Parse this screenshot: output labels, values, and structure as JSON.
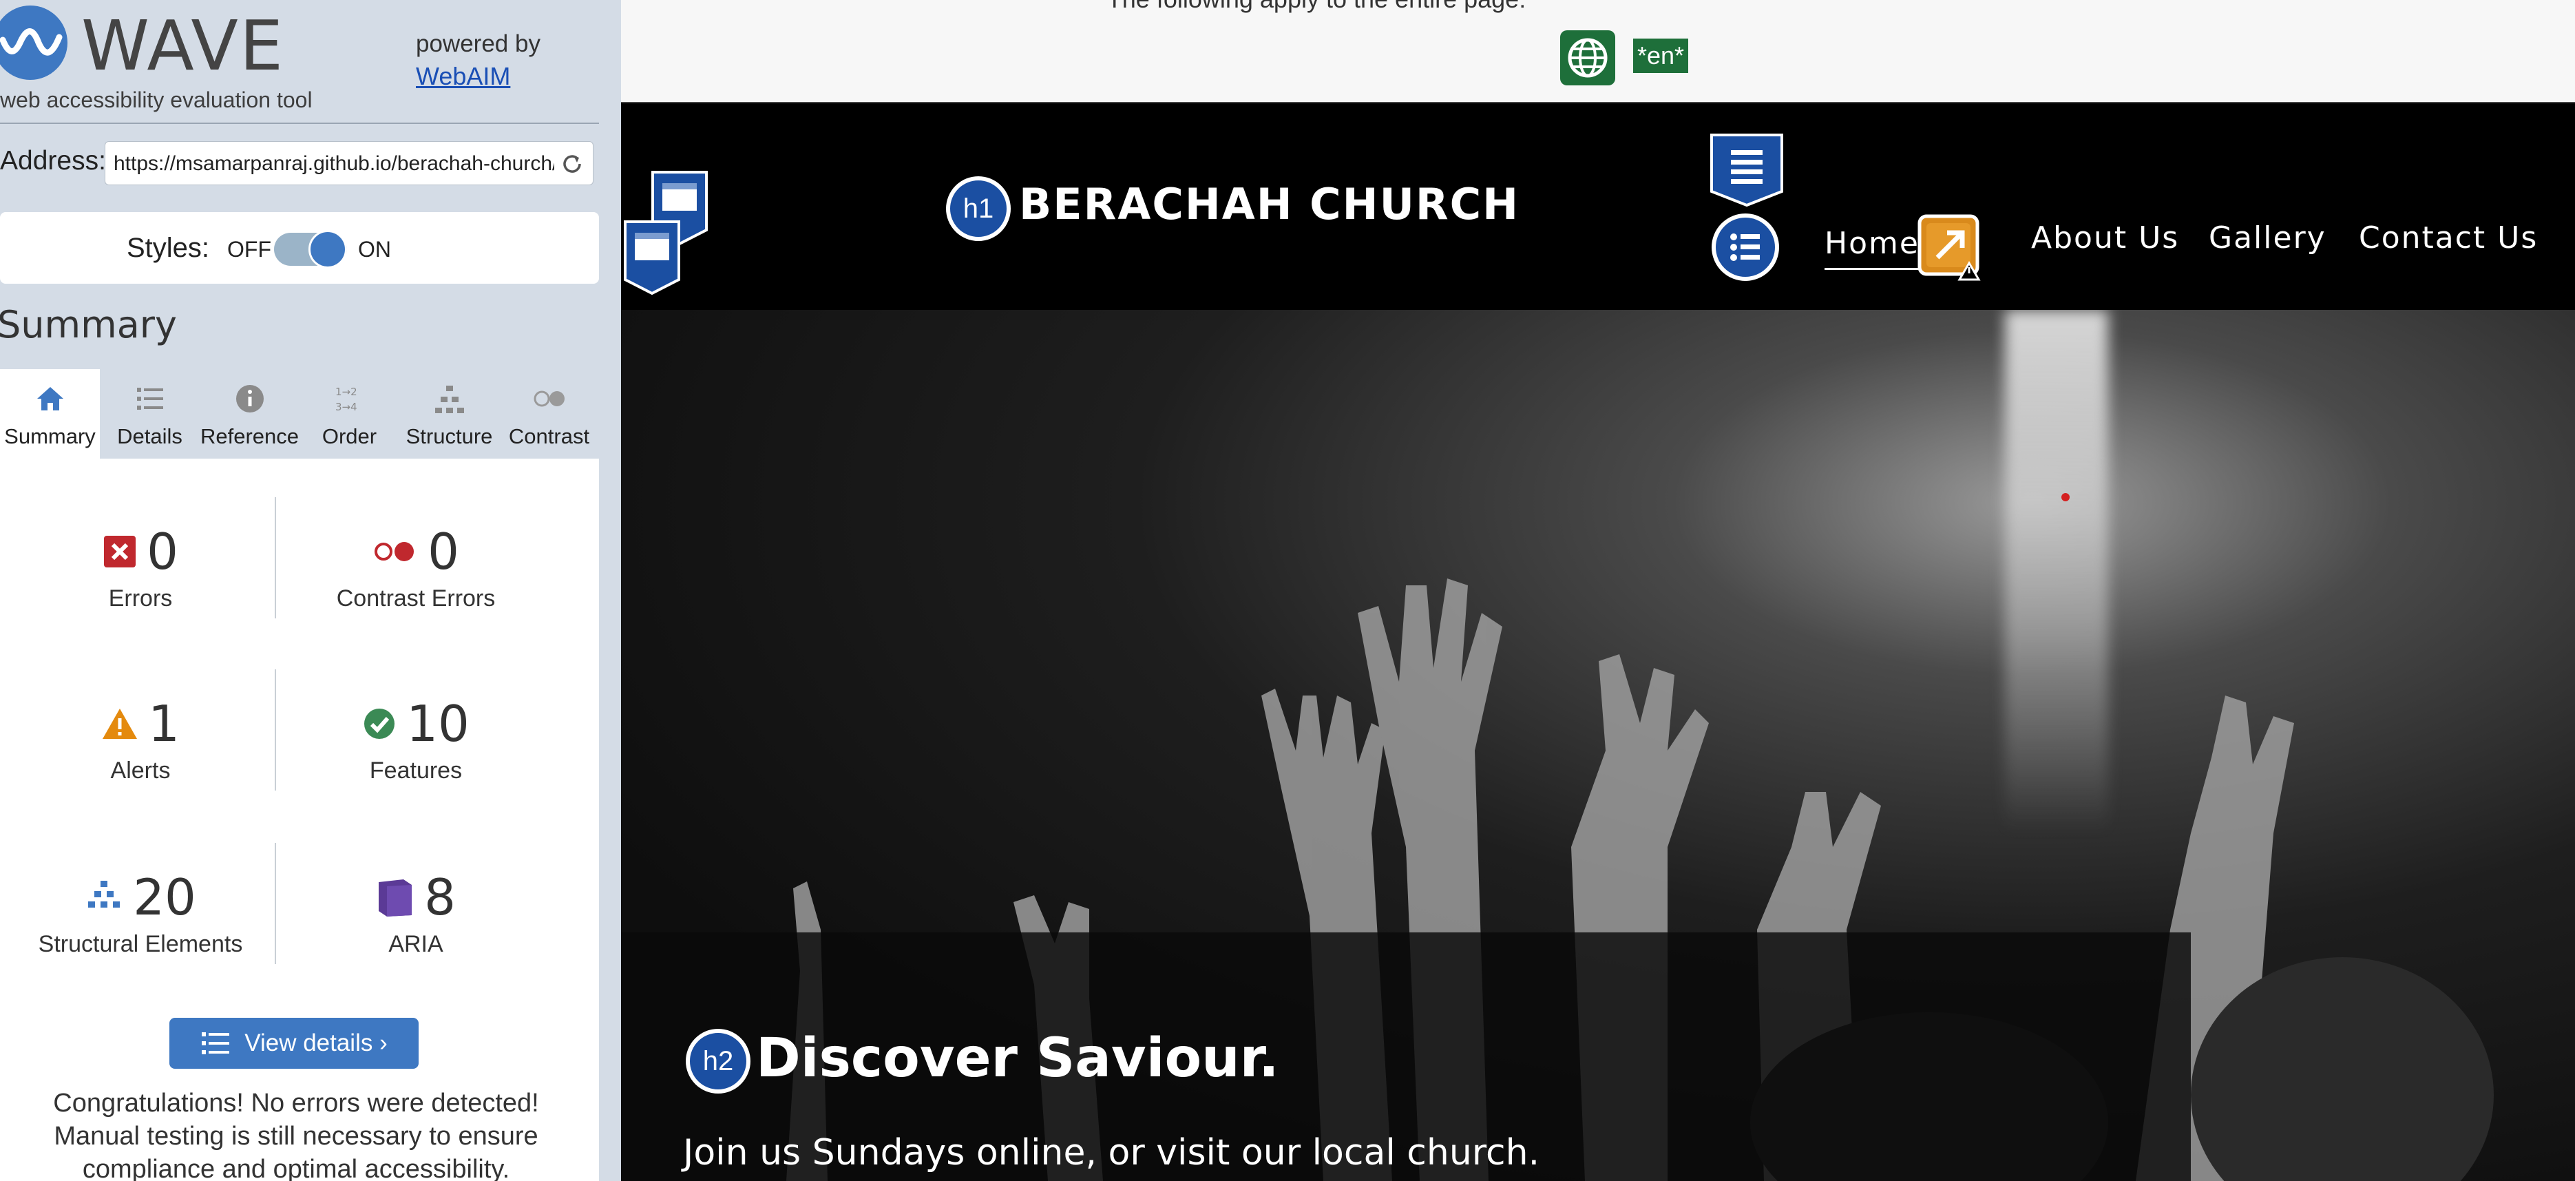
{
  "wave": {
    "logo_text": "WAVE",
    "tagline": "web accessibility evaluation tool",
    "powered_by": "powered by",
    "webaim_link": "WebAIM",
    "address_label": "Address:",
    "address_value": "https://msamarpanraj.github.io/berachah-church/",
    "styles_label": "Styles:",
    "styles_off": "OFF",
    "styles_on": "ON",
    "summary_heading": "Summary",
    "tabs": [
      {
        "label": "Summary",
        "icon": "home-icon"
      },
      {
        "label": "Details",
        "icon": "list-icon"
      },
      {
        "label": "Reference",
        "icon": "info-icon"
      },
      {
        "label": "Order",
        "icon": "order-icon"
      },
      {
        "label": "Structure",
        "icon": "hierarchy-icon"
      },
      {
        "label": "Contrast",
        "icon": "contrast-icon"
      }
    ],
    "stats": {
      "errors": {
        "value": "0",
        "label": "Errors"
      },
      "contrast_errors": {
        "value": "0",
        "label": "Contrast Errors"
      },
      "alerts": {
        "value": "1",
        "label": "Alerts"
      },
      "features": {
        "value": "10",
        "label": "Features"
      },
      "structural": {
        "value": "20",
        "label": "Structural Elements"
      },
      "aria": {
        "value": "8",
        "label": "ARIA"
      }
    },
    "view_details": "View details ›",
    "congrats": "Congratulations! No errors were detected! Manual testing is still necessary to ensure compliance and optimal accessibility."
  },
  "page": {
    "lang_note": "The following apply to the entire page:",
    "lang_badge": "*en*",
    "h1_badge": "h1",
    "site_title": "BERACHAH CHURCH",
    "nav": [
      "Home",
      "About Us",
      "Gallery",
      "Contact Us"
    ],
    "h2_badge": "h2",
    "hero_heading": "Discover Saviour.",
    "hero_sub": "Join us Sundays online, or visit our local church."
  },
  "colors": {
    "wave_blue": "#3e78c2",
    "error_red": "#c0282e",
    "alert_orange": "#e48a0e",
    "feature_green": "#3b8a55",
    "aria_purple": "#5b3a96",
    "lang_green": "#1e6f3a"
  }
}
